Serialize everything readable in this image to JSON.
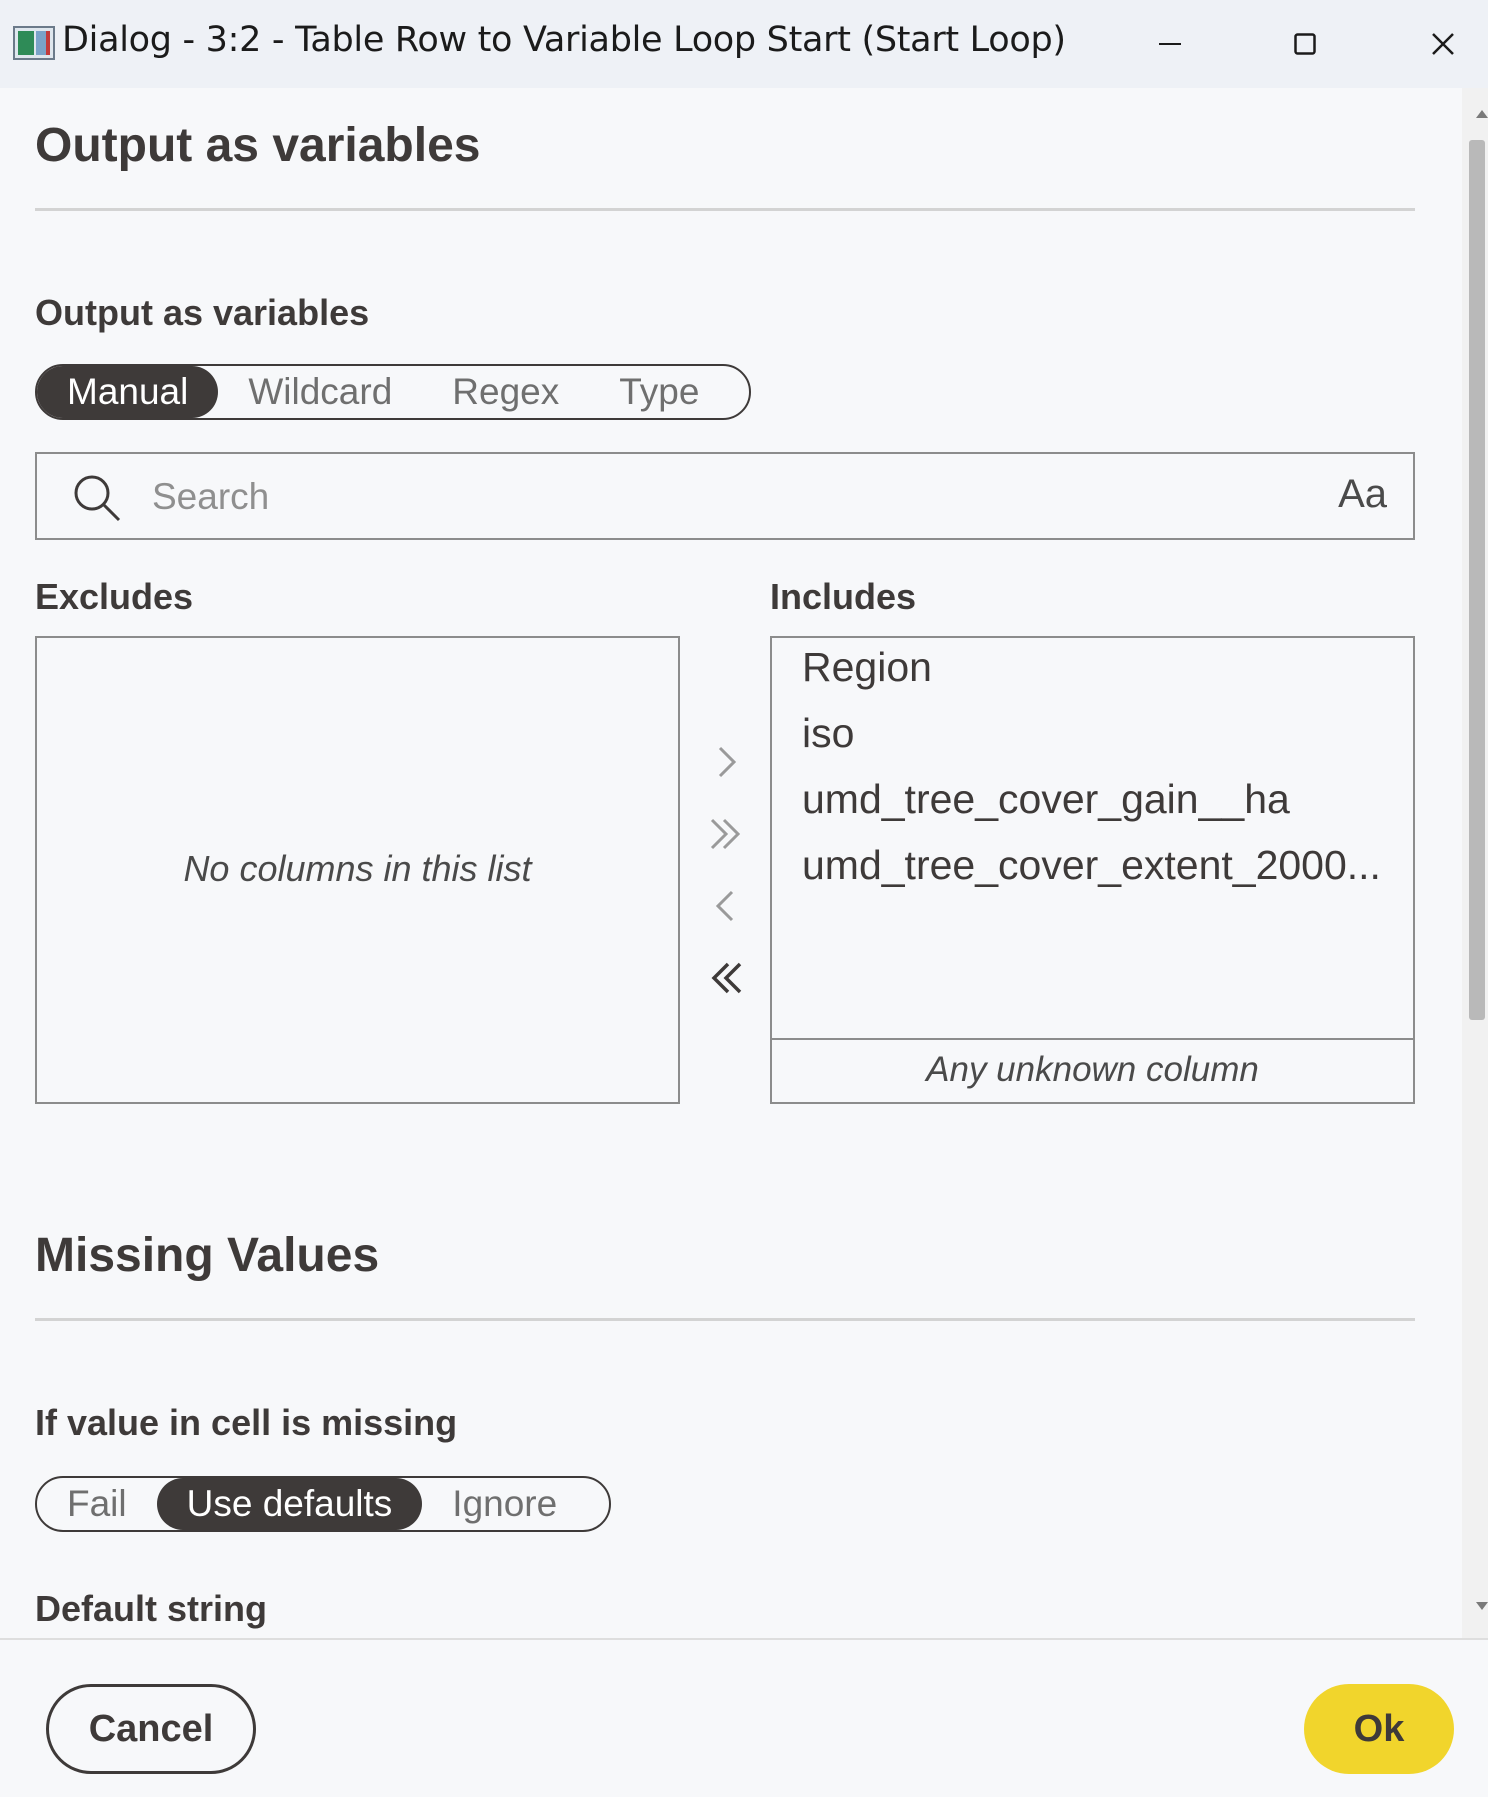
{
  "window": {
    "title": "Dialog - 3:2 - Table Row to Variable Loop Start (Start Loop)",
    "icons": [
      "app-icon",
      "minimize-icon",
      "maximize-icon",
      "close-icon"
    ]
  },
  "output_section": {
    "title": "Output as variables",
    "field_label": "Output as variables",
    "modes": [
      "Manual",
      "Wildcard",
      "Regex",
      "Type"
    ],
    "selected_mode": "Manual",
    "search_placeholder": "Search",
    "case_toggle": "Aa",
    "excludes_label": "Excludes",
    "excludes_empty": "No columns in this list",
    "includes_label": "Includes",
    "includes_items": [
      "Region",
      "iso",
      "umd_tree_cover_gain__ha",
      "umd_tree_cover_extent_2000..."
    ],
    "includes_footer": "Any unknown column"
  },
  "missing_section": {
    "title": "Missing Values",
    "field_label": "If value in cell is missing",
    "options": [
      "Fail",
      "Use defaults",
      "Ignore"
    ],
    "selected_option": "Use defaults",
    "default_string_label": "Default string"
  },
  "footer": {
    "cancel_label": "Cancel",
    "ok_label": "Ok"
  },
  "colors": {
    "accent_ok": "#f1d52c",
    "active_segment": "#3e3a39"
  }
}
